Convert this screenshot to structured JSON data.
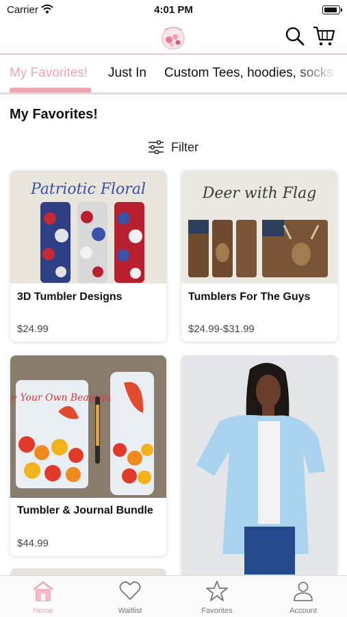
{
  "status_bar": {
    "carrier": "Carrier",
    "time": "4:01 PM"
  },
  "header": {
    "logo": "store-logo"
  },
  "tabs": [
    {
      "label": "My Favorites!",
      "active": true
    },
    {
      "label": "Just In",
      "active": false
    },
    {
      "label": "Custom Tees, hoodies, socks",
      "active": false
    }
  ],
  "page": {
    "title": "My Favorites!",
    "filter_label": "Filter"
  },
  "products": [
    {
      "name": "3D Tumbler Designs",
      "price": "$24.99",
      "image_text": "Patriotic Floral"
    },
    {
      "name": "Tumblers For The Guys",
      "price": "$24.99-$31.99",
      "image_text": "Deer with Flag"
    },
    {
      "name": "Tumbler & Journal Bundle",
      "price": "$44.99",
      "image_text": "Be Your Own Beautiful"
    },
    {
      "name": "",
      "price": ""
    }
  ],
  "bottom_nav": [
    {
      "label": "Home",
      "icon": "home-icon",
      "active": true
    },
    {
      "label": "Waitlist",
      "icon": "heart-icon",
      "active": false
    },
    {
      "label": "Favorites",
      "icon": "star-icon",
      "active": false
    },
    {
      "label": "Account",
      "icon": "person-icon",
      "active": false
    }
  ],
  "colors": {
    "accent": "#f0a5b3",
    "divider": "#f0c7cf"
  }
}
